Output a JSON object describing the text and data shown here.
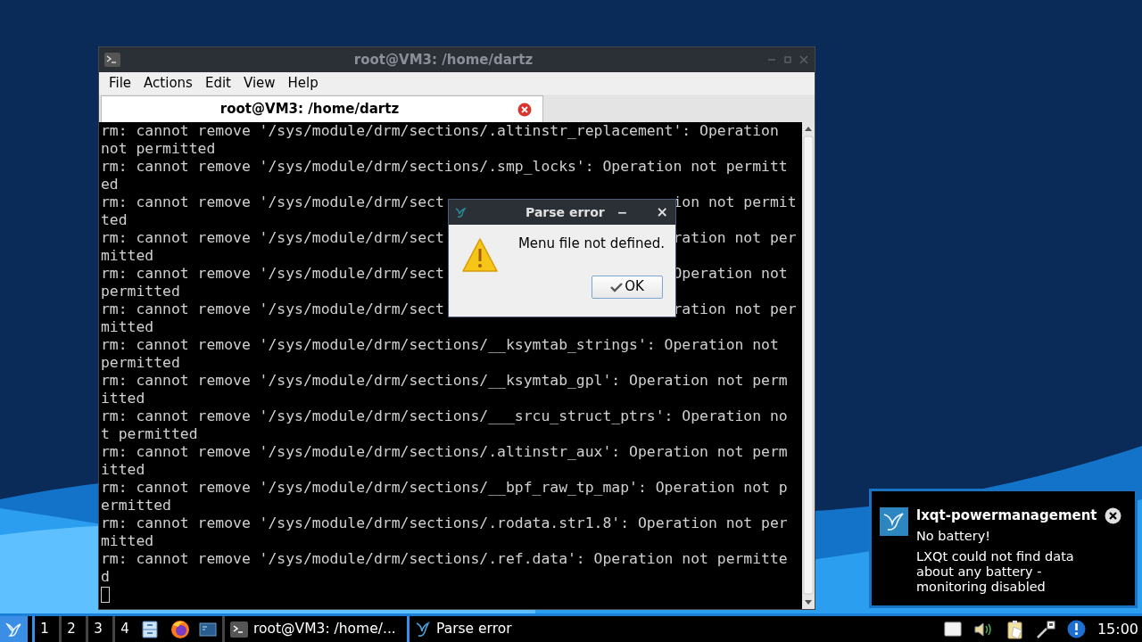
{
  "terminal": {
    "title": "root@VM3: /home/dartz",
    "menu": [
      "File",
      "Actions",
      "Edit",
      "View",
      "Help"
    ],
    "tabs": [
      {
        "label": "root@VM3: /home/dartz",
        "selected": true
      }
    ],
    "lines": [
      {
        "kind": "full",
        "text": "rm: cannot remove '/sys/module/drm/sections/.altinstr_replacement': Operation"
      },
      {
        "kind": "full",
        "text": "not permitted"
      },
      {
        "kind": "full",
        "text": "rm: cannot remove '/sys/module/drm/sections/.smp_locks': Operation not permitt"
      },
      {
        "kind": "full",
        "text": "ed"
      },
      {
        "kind": "split",
        "left": "rm: cannot remove '/sys/module/drm/sect",
        "right": "ion not permit"
      },
      {
        "kind": "full",
        "text": "ted"
      },
      {
        "kind": "split",
        "left": "rm: cannot remove '/sys/module/drm/sect",
        "right": "ration not per"
      },
      {
        "kind": "full",
        "text": "mitted"
      },
      {
        "kind": "split",
        "left": "rm: cannot remove '/sys/module/drm/sect",
        "right": "Operation not "
      },
      {
        "kind": "full",
        "text": "permitted"
      },
      {
        "kind": "split",
        "left": "rm: cannot remove '/sys/module/drm/sect",
        "right": "ration not per"
      },
      {
        "kind": "full",
        "text": "mitted"
      },
      {
        "kind": "full",
        "text": "rm: cannot remove '/sys/module/drm/sections/__ksymtab_strings': Operation not"
      },
      {
        "kind": "full",
        "text": "permitted"
      },
      {
        "kind": "full",
        "text": "rm: cannot remove '/sys/module/drm/sections/__ksymtab_gpl': Operation not perm"
      },
      {
        "kind": "full",
        "text": "itted"
      },
      {
        "kind": "full",
        "text": "rm: cannot remove '/sys/module/drm/sections/___srcu_struct_ptrs': Operation no"
      },
      {
        "kind": "full",
        "text": "t permitted"
      },
      {
        "kind": "full",
        "text": "rm: cannot remove '/sys/module/drm/sections/.altinstr_aux': Operation not perm"
      },
      {
        "kind": "full",
        "text": "itted"
      },
      {
        "kind": "full",
        "text": "rm: cannot remove '/sys/module/drm/sections/__bpf_raw_tp_map': Operation not p"
      },
      {
        "kind": "full",
        "text": "ermitted"
      },
      {
        "kind": "full",
        "text": "rm: cannot remove '/sys/module/drm/sections/.rodata.str1.8': Operation not per"
      },
      {
        "kind": "full",
        "text": "mitted"
      },
      {
        "kind": "full",
        "text": "rm: cannot remove '/sys/module/drm/sections/.ref.data': Operation not permitte"
      },
      {
        "kind": "full",
        "text": "d"
      },
      {
        "kind": "cursor"
      }
    ]
  },
  "dialog": {
    "title": "Parse error",
    "minimize": "−",
    "close": "×",
    "message": "Menu file not defined.",
    "button": "OK"
  },
  "notification": {
    "app": "lxqt-powermanagement",
    "summary": "No battery!",
    "body": "LXQt could not find data about any battery - monitoring disabled"
  },
  "taskbar": {
    "desktops": [
      {
        "label": "1",
        "selected": true
      },
      {
        "label": "2",
        "selected": false
      },
      {
        "label": "3",
        "selected": false
      },
      {
        "label": "4",
        "selected": false
      }
    ],
    "tasks": [
      {
        "kind": "terminal",
        "label": "root@VM3: /home/...",
        "selected": false
      },
      {
        "kind": "dialog",
        "label": "Parse error",
        "selected": true
      }
    ],
    "clock": "15:00"
  }
}
